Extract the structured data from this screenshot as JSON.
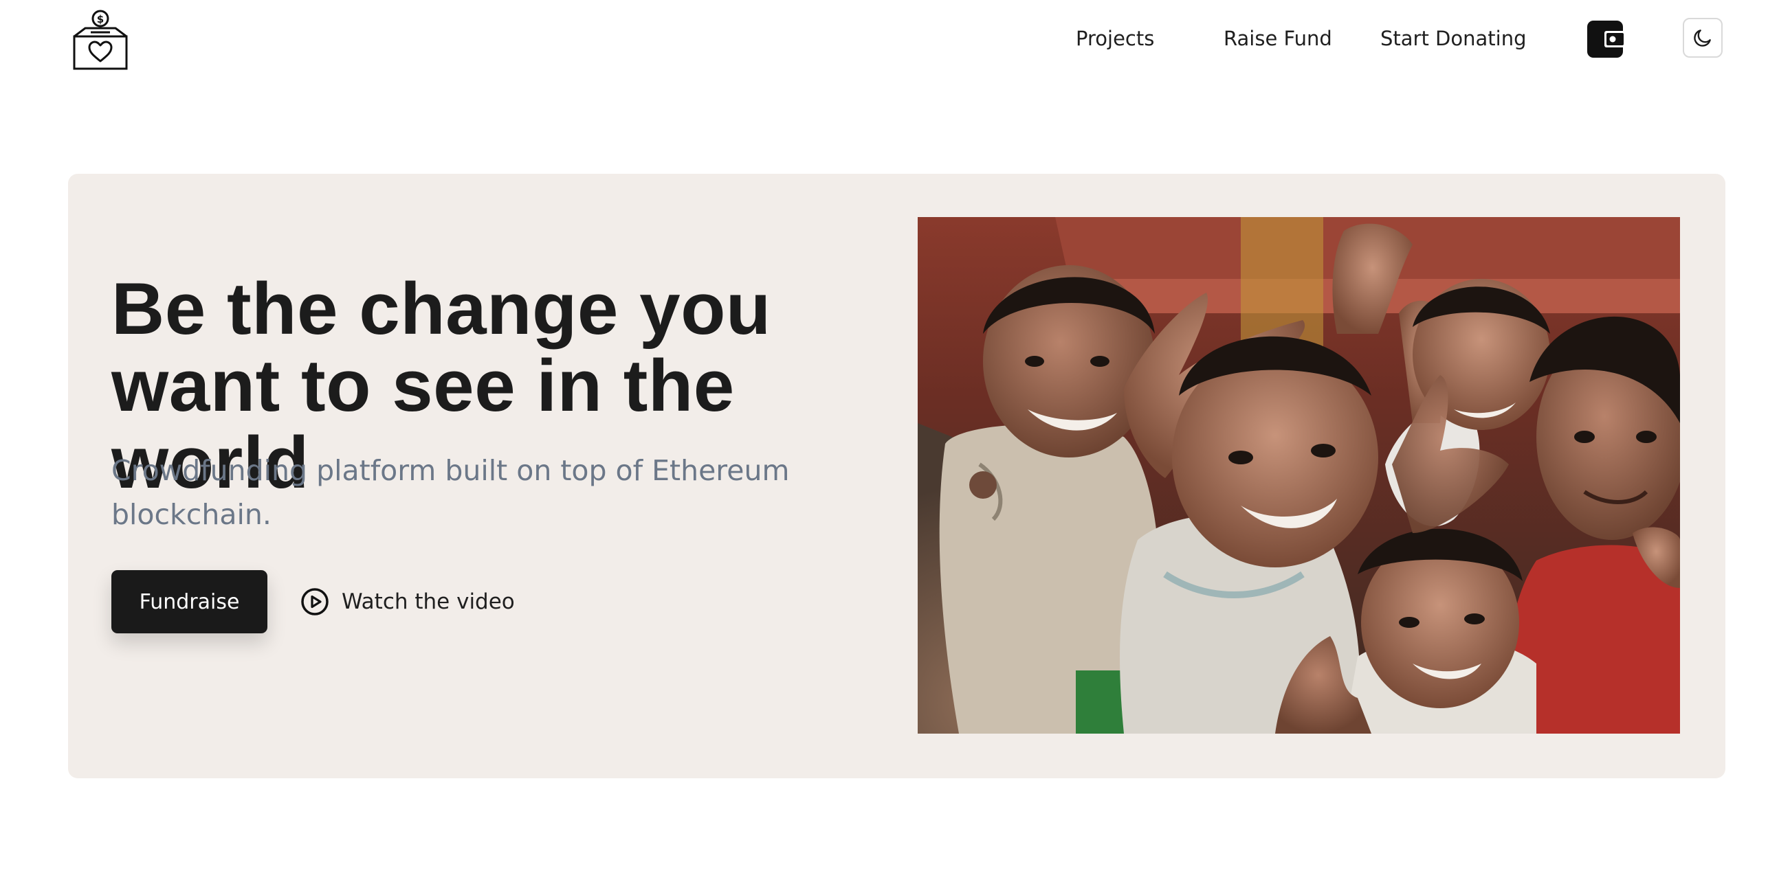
{
  "nav": {
    "logo_alt": "donation box with heart and coin",
    "links": [
      {
        "label": "Projects"
      },
      {
        "label": "Raise Fund"
      },
      {
        "label": "Start Donating"
      }
    ],
    "wallet_icon": "wallet-icon",
    "theme_icon": "moon-icon"
  },
  "hero": {
    "title": "Be the change you want to see in the world",
    "subtitle": "Crowdfunding platform built on top of Ethereum blockchain.",
    "primary_button": "Fundraise",
    "secondary_link": "Watch the video",
    "secondary_icon": "play-circle-icon",
    "image_subject": "group of smiling children"
  },
  "colors": {
    "hero_background": "#f2ede9",
    "primary_button": "#1a1a1a",
    "subtitle_text": "#6b7788"
  }
}
